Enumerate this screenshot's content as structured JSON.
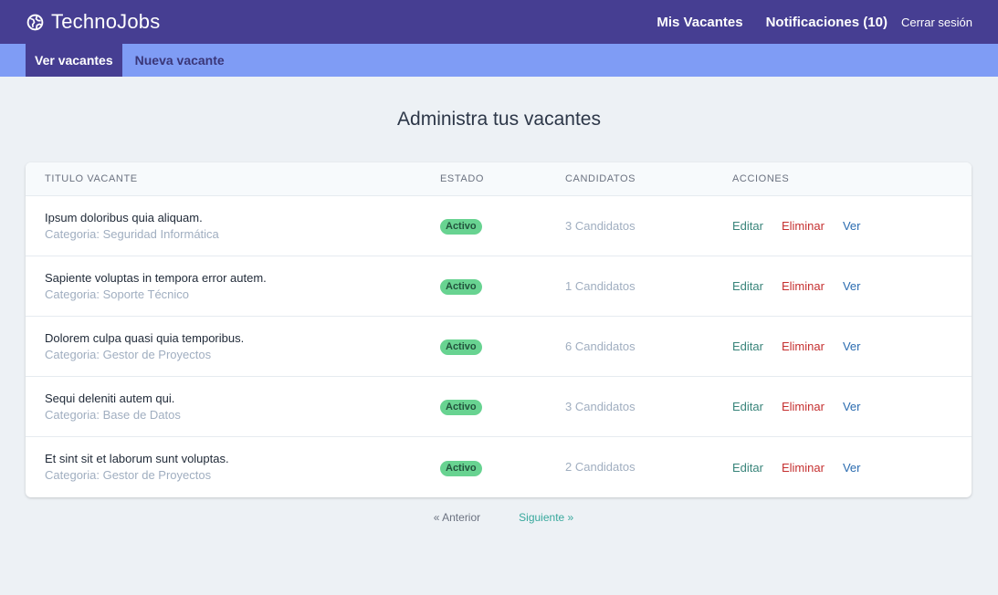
{
  "navbar": {
    "brand": "TechnoJobs",
    "brand_icon": "globe-icon",
    "links": {
      "my_vacancies": "Mis Vacantes",
      "notifications": "Notificaciones (10)",
      "logout": "Cerrar sesión"
    }
  },
  "subnav": {
    "view_vacancies": "Ver vacantes",
    "new_vacancy": "Nueva vacante"
  },
  "page": {
    "title": "Administra tus vacantes"
  },
  "table": {
    "headers": {
      "title": "TITULO VACANTE",
      "state": "ESTADO",
      "candidates": "CANDIDATOS",
      "actions": "ACCIONES"
    },
    "rows": [
      {
        "title": "Ipsum doloribus quia aliquam.",
        "category": "Categoria: Seguridad Informática",
        "state": "Activo",
        "candidates": "3 Candidatos",
        "edit": "Editar",
        "delete": "Eliminar",
        "view": "Ver"
      },
      {
        "title": "Sapiente voluptas in tempora error autem.",
        "category": "Categoria: Soporte Técnico",
        "state": "Activo",
        "candidates": "1 Candidatos",
        "edit": "Editar",
        "delete": "Eliminar",
        "view": "Ver"
      },
      {
        "title": "Dolorem culpa quasi quia temporibus.",
        "category": "Categoria: Gestor de Proyectos",
        "state": "Activo",
        "candidates": "6 Candidatos",
        "edit": "Editar",
        "delete": "Eliminar",
        "view": "Ver"
      },
      {
        "title": "Sequi deleniti autem qui.",
        "category": "Categoria: Base de Datos",
        "state": "Activo",
        "candidates": "3 Candidatos",
        "edit": "Editar",
        "delete": "Eliminar",
        "view": "Ver"
      },
      {
        "title": "Et sint sit et laborum sunt voluptas.",
        "category": "Categoria: Gestor de Proyectos",
        "state": "Activo",
        "candidates": "2 Candidatos",
        "edit": "Editar",
        "delete": "Eliminar",
        "view": "Ver"
      }
    ]
  },
  "pagination": {
    "prev": "« Anterior",
    "next": "Siguiente »"
  },
  "colors": {
    "navbar": "#463e92",
    "subnav": "#7f9cf5",
    "badge": "#68d391",
    "edit": "#38847a",
    "delete": "#c53030",
    "view": "#2b6cb0"
  }
}
